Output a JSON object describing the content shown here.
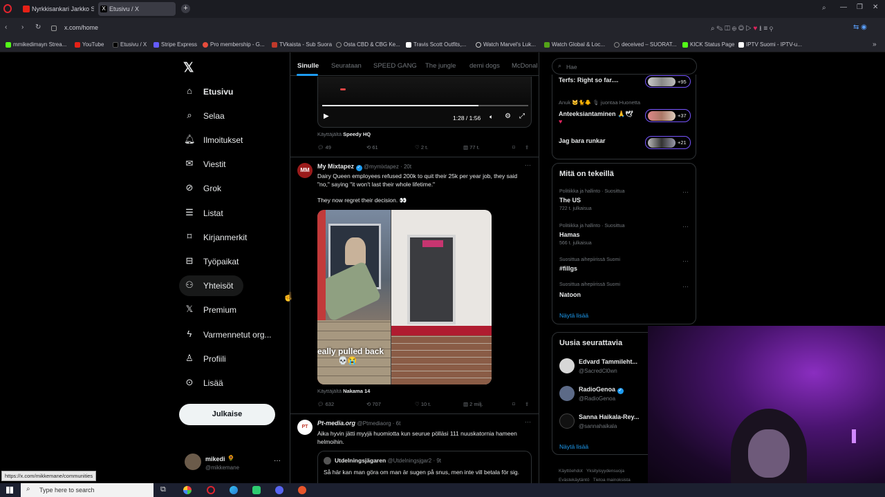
{
  "browser": {
    "tabs": [
      {
        "label": "Nyrkkisankari Jarkko Steni",
        "active": false
      },
      {
        "label": "Etusivu / X",
        "active": true
      }
    ],
    "url": "x.com/home",
    "bookmarks": [
      "mmikedimayn Strea...",
      "YouTube",
      "Etusivu / X",
      "Stripe Express",
      "Pro membership - G...",
      "TVkaista - Sub Suora",
      "Osta CBD & CBG Ke...",
      "Travis Scott Outfits,...",
      "Watch Marvel's Luk...",
      "Watch Global & Loc...",
      "deceived – SUORAT...",
      "KICK Status Page",
      "IPTV Suomi - IPTV-u..."
    ],
    "status_url": "https://x.com/mikkemane/communities"
  },
  "nav": {
    "items": [
      "Etusivu",
      "Selaa",
      "Ilmoitukset",
      "Viestit",
      "Grok",
      "Listat",
      "Kirjanmerkit",
      "Työpaikat",
      "Yhteisöt",
      "Premium",
      "Varmennetut org...",
      "Profiili",
      "Lisää"
    ],
    "post_button": "Julkaise",
    "user_name": "mikedi",
    "user_handle": "@mikkemane"
  },
  "feed": {
    "tabs": [
      "Sinulle",
      "Seurataan",
      "SPEED GANG",
      "The jungle",
      "demi dogs",
      "McDonal"
    ],
    "video_time": "1:28 / 1:56",
    "video_progress": 0.76,
    "source1_prefix": "Käyttäjältä",
    "source1_name": "Speedy HQ",
    "post1_stats": {
      "replies": "49",
      "reposts": "61",
      "likes": "2 t.",
      "views": "77 t."
    },
    "post2": {
      "name": "My Mixtapez",
      "handle": "@mymixtapez · 20t",
      "text1": "Dairy Queen employees refused 200k to quit their 25k per year job, they said \"no,\" saying \"it won't last their whole lifetime.\"",
      "text2": "They now regret their decision. 👀",
      "image_caption": "eally pulled back",
      "source_prefix": "Käyttäjältä",
      "source_name": "Nakama 14",
      "stats": {
        "replies": "632",
        "reposts": "707",
        "likes": "10 t.",
        "views": "2 milj."
      }
    },
    "post3": {
      "name": "Pt-media.org",
      "handle": "@Ptmediaorg · 6t",
      "text": "Aika hyvin jätti myyjä huomiotta kun seurue pölläsi 111 nuuskatornia hameen helmoihin.",
      "quote_name": "Utdelningsjägaren",
      "quote_handle": "@Utdelningsjgar2 · 9t",
      "quote_text": "Så här kan man göra om man är sugen på snus, men inte vill betala för sig."
    }
  },
  "right": {
    "search_placeholder": "Hae",
    "spaces": [
      {
        "title": "Terfs: Right so far....",
        "count": "+95"
      },
      {
        "host": "Anuk 🐱🐈🐥 🎙 juontaa Huonetta",
        "title": "Anteeksiantaminen 🙏🕊",
        "count": "+37"
      },
      {
        "title": "Jag bara runkar",
        "count": "+21"
      }
    ],
    "trends_title": "Mitä on tekeillä",
    "trends": [
      {
        "category": "Politiikka ja hallinto · Suosittua",
        "name": "The US",
        "count": "722 t. julkaisua"
      },
      {
        "category": "Politiikka ja hallinto · Suosittua",
        "name": "Hamas",
        "count": "566 t. julkaisua"
      },
      {
        "category": "Suosittua aihepiirissä Suomi",
        "name": "#fillgs",
        "count": ""
      },
      {
        "category": "Suosittua aihepiirissä Suomi",
        "name": "Natoon",
        "count": ""
      }
    ],
    "show_more": "Näytä lisää",
    "follow_title": "Uusia seurattavia",
    "follow": [
      {
        "name": "Edvard Tammileht...",
        "handle": "@SacredCl0wn"
      },
      {
        "name": "RadioGenoa",
        "handle": "@RadioGenoa"
      },
      {
        "name": "Sanna Haikala-Rey...",
        "handle": "@sannahaikala"
      }
    ],
    "follow_more": "Näytä lisää",
    "footer": [
      "Käyttöehdot",
      "Yksityisyydensuoja",
      "Evästekäytäntö",
      "Tietoa mainoksista"
    ]
  },
  "taskbar": {
    "search_placeholder": "Type here to search"
  },
  "colors": {
    "accent": "#1d9bf0",
    "bg": "#000000",
    "border": "#2f3336"
  }
}
